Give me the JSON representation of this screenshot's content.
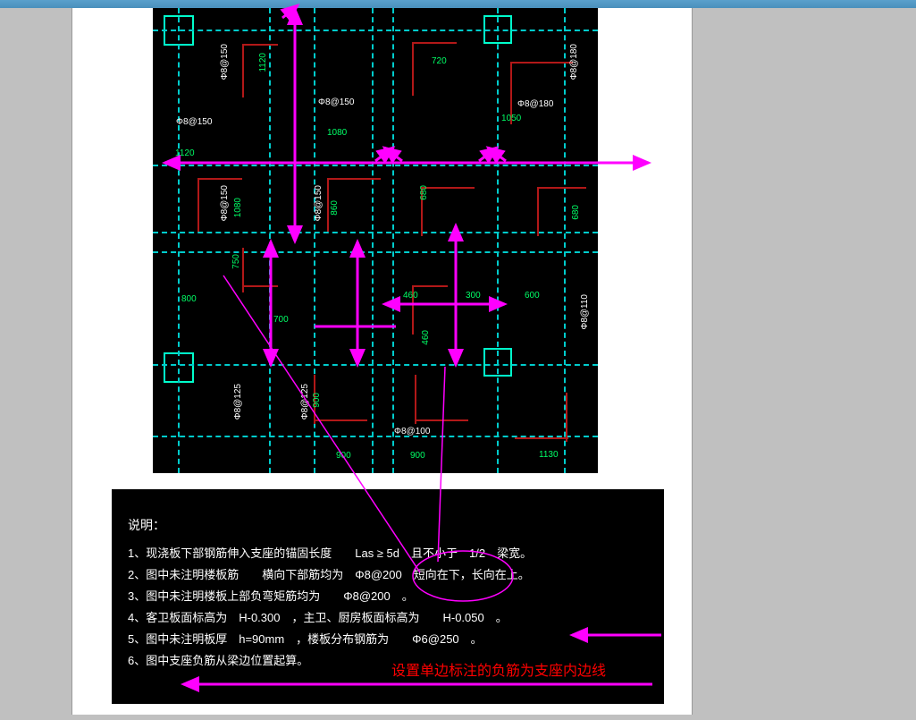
{
  "cad": {
    "labels": {
      "l1": "Φ8@150",
      "l2": "Φ8@150",
      "l3": "Φ8@150",
      "l4": "Φ8@180",
      "l5": "Φ8@180",
      "l6": "Φ8@150",
      "l7": "Φ8@150",
      "l8": "Φ8@125",
      "l9": "Φ8@125",
      "l10": "Φ8@100",
      "l11": "Φ8@110"
    },
    "dims": {
      "d1": "720",
      "d2": "1120",
      "d3": "1080",
      "d4": "1050",
      "d5": "1120",
      "d6": "1080",
      "d7": "860",
      "d8": "680",
      "d9": "680",
      "d10": "750",
      "d11": "800",
      "d12": "700",
      "d13": "460",
      "d14": "300",
      "d15": "600",
      "d16": "460",
      "d17": "900",
      "d18": "900",
      "d19": "900",
      "d20": "1130"
    }
  },
  "notes": {
    "title": "说明：",
    "line1": "1、现浇板下部钢筋伸入支座的锚固长度　　Las ≥ 5d　且不小于　1/2　梁宽。",
    "line2": "2、图中未注明楼板筋　　横向下部筋均为　Φ8@200　短向在下，长向在上。",
    "line3": "3、图中未注明楼板上部负弯矩筋均为　　Φ8@200　。",
    "line4": "4、客卫板面标高为　H-0.300　，主卫、厨房板面标高为　　H-0.050　。",
    "line5": "5、图中未注明板厚　h=90mm　，楼板分布钢筋为　　Φ6@250　。",
    "line6": "6、图中支座负筋从梁边位置起算。",
    "annotation": "设置单边标注的负筋为支座内边线"
  }
}
